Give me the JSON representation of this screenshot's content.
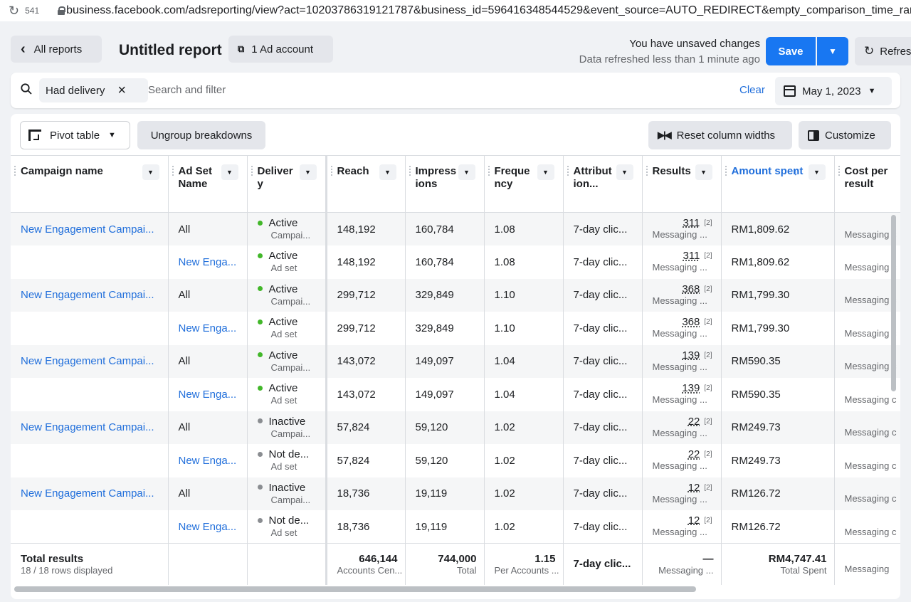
{
  "browser": {
    "count": "541",
    "url": "business.facebook.com/adsreporting/view?act=10203786319121787&business_id=596416348544529&event_source=AUTO_REDIRECT&empty_comparison_time_range=true"
  },
  "header": {
    "back_label": "All reports",
    "title": "Untitled report",
    "ad_account_label": "1 Ad account",
    "unsaved": "You have unsaved changes",
    "refreshed": "Data refreshed less than 1 minute ago",
    "save_label": "Save",
    "refresh_label": "Refresh"
  },
  "filter": {
    "chip": "Had delivery",
    "placeholder": "Search and filter",
    "clear": "Clear",
    "date": "May 1, 2023"
  },
  "toolbar": {
    "pivot": "Pivot table",
    "ungroup": "Ungroup breakdowns",
    "reset": "Reset column widths",
    "customize": "Customize"
  },
  "columns": [
    "Campaign name",
    "Ad Set Name",
    "Delivery",
    "Reach",
    "Impressions",
    "Frequency",
    "Attribution...",
    "Results",
    "Amount spent",
    "Cost per result"
  ],
  "rows": [
    {
      "campaign": "New Engagement Campai...",
      "adset": "All",
      "status": "Active",
      "level": "Campai...",
      "reach": "148,192",
      "impr": "160,784",
      "freq": "1.08",
      "attr": "7-day clic...",
      "results": "311",
      "sup": "[2]",
      "rtype": "Messaging ...",
      "amount": "RM1,809.62",
      "cost": "Messaging c"
    },
    {
      "campaign": "",
      "adset": "New Enga...",
      "status": "Active",
      "level": "Ad set",
      "reach": "148,192",
      "impr": "160,784",
      "freq": "1.08",
      "attr": "7-day clic...",
      "results": "311",
      "sup": "[2]",
      "rtype": "Messaging ...",
      "amount": "RM1,809.62",
      "cost": "Messaging c"
    },
    {
      "campaign": "New Engagement Campai...",
      "adset": "All",
      "status": "Active",
      "level": "Campai...",
      "reach": "299,712",
      "impr": "329,849",
      "freq": "1.10",
      "attr": "7-day clic...",
      "results": "368",
      "sup": "[2]",
      "rtype": "Messaging ...",
      "amount": "RM1,799.30",
      "cost": "Messaging c"
    },
    {
      "campaign": "",
      "adset": "New Enga...",
      "status": "Active",
      "level": "Ad set",
      "reach": "299,712",
      "impr": "329,849",
      "freq": "1.10",
      "attr": "7-day clic...",
      "results": "368",
      "sup": "[2]",
      "rtype": "Messaging ...",
      "amount": "RM1,799.30",
      "cost": "Messaging c"
    },
    {
      "campaign": "New Engagement Campai...",
      "adset": "All",
      "status": "Active",
      "level": "Campai...",
      "reach": "143,072",
      "impr": "149,097",
      "freq": "1.04",
      "attr": "7-day clic...",
      "results": "139",
      "sup": "[2]",
      "rtype": "Messaging ...",
      "amount": "RM590.35",
      "cost": "Messaging c"
    },
    {
      "campaign": "",
      "adset": "New Enga...",
      "status": "Active",
      "level": "Ad set",
      "reach": "143,072",
      "impr": "149,097",
      "freq": "1.04",
      "attr": "7-day clic...",
      "results": "139",
      "sup": "[2]",
      "rtype": "Messaging ...",
      "amount": "RM590.35",
      "cost": "Messaging c"
    },
    {
      "campaign": "New Engagement Campai...",
      "adset": "All",
      "status": "Inactive",
      "level": "Campai...",
      "reach": "57,824",
      "impr": "59,120",
      "freq": "1.02",
      "attr": "7-day clic...",
      "results": "22",
      "sup": "[2]",
      "rtype": "Messaging ...",
      "amount": "RM249.73",
      "cost": "Messaging c"
    },
    {
      "campaign": "",
      "adset": "New Enga...",
      "status": "Not de...",
      "level": "Ad set",
      "reach": "57,824",
      "impr": "59,120",
      "freq": "1.02",
      "attr": "7-day clic...",
      "results": "22",
      "sup": "[2]",
      "rtype": "Messaging ...",
      "amount": "RM249.73",
      "cost": "Messaging c"
    },
    {
      "campaign": "New Engagement Campai...",
      "adset": "All",
      "status": "Inactive",
      "level": "Campai...",
      "reach": "18,736",
      "impr": "19,119",
      "freq": "1.02",
      "attr": "7-day clic...",
      "results": "12",
      "sup": "[2]",
      "rtype": "Messaging ...",
      "amount": "RM126.72",
      "cost": "Messaging c"
    },
    {
      "campaign": "",
      "adset": "New Enga...",
      "status": "Not de...",
      "level": "Ad set",
      "reach": "18,736",
      "impr": "19,119",
      "freq": "1.02",
      "attr": "7-day clic...",
      "results": "12",
      "sup": "[2]",
      "rtype": "Messaging ...",
      "amount": "RM126.72",
      "cost": "Messaging c"
    }
  ],
  "totals": {
    "label": "Total results",
    "rows_displayed": "18 / 18 rows displayed",
    "reach": "646,144",
    "reach_sub": "Accounts Cen...",
    "impr": "744,000",
    "impr_sub": "Total",
    "freq": "1.15",
    "freq_sub": "Per Accounts ...",
    "attr": "7-day clic...",
    "results": "—",
    "results_sub": "Messaging ...",
    "amount": "RM4,747.41",
    "amount_sub": "Total Spent",
    "cost_sub": "Messaging"
  },
  "colors": {
    "accent": "#1877f2",
    "link": "#216fdb",
    "active": "#42b72a",
    "inactive": "#8a8d91"
  }
}
